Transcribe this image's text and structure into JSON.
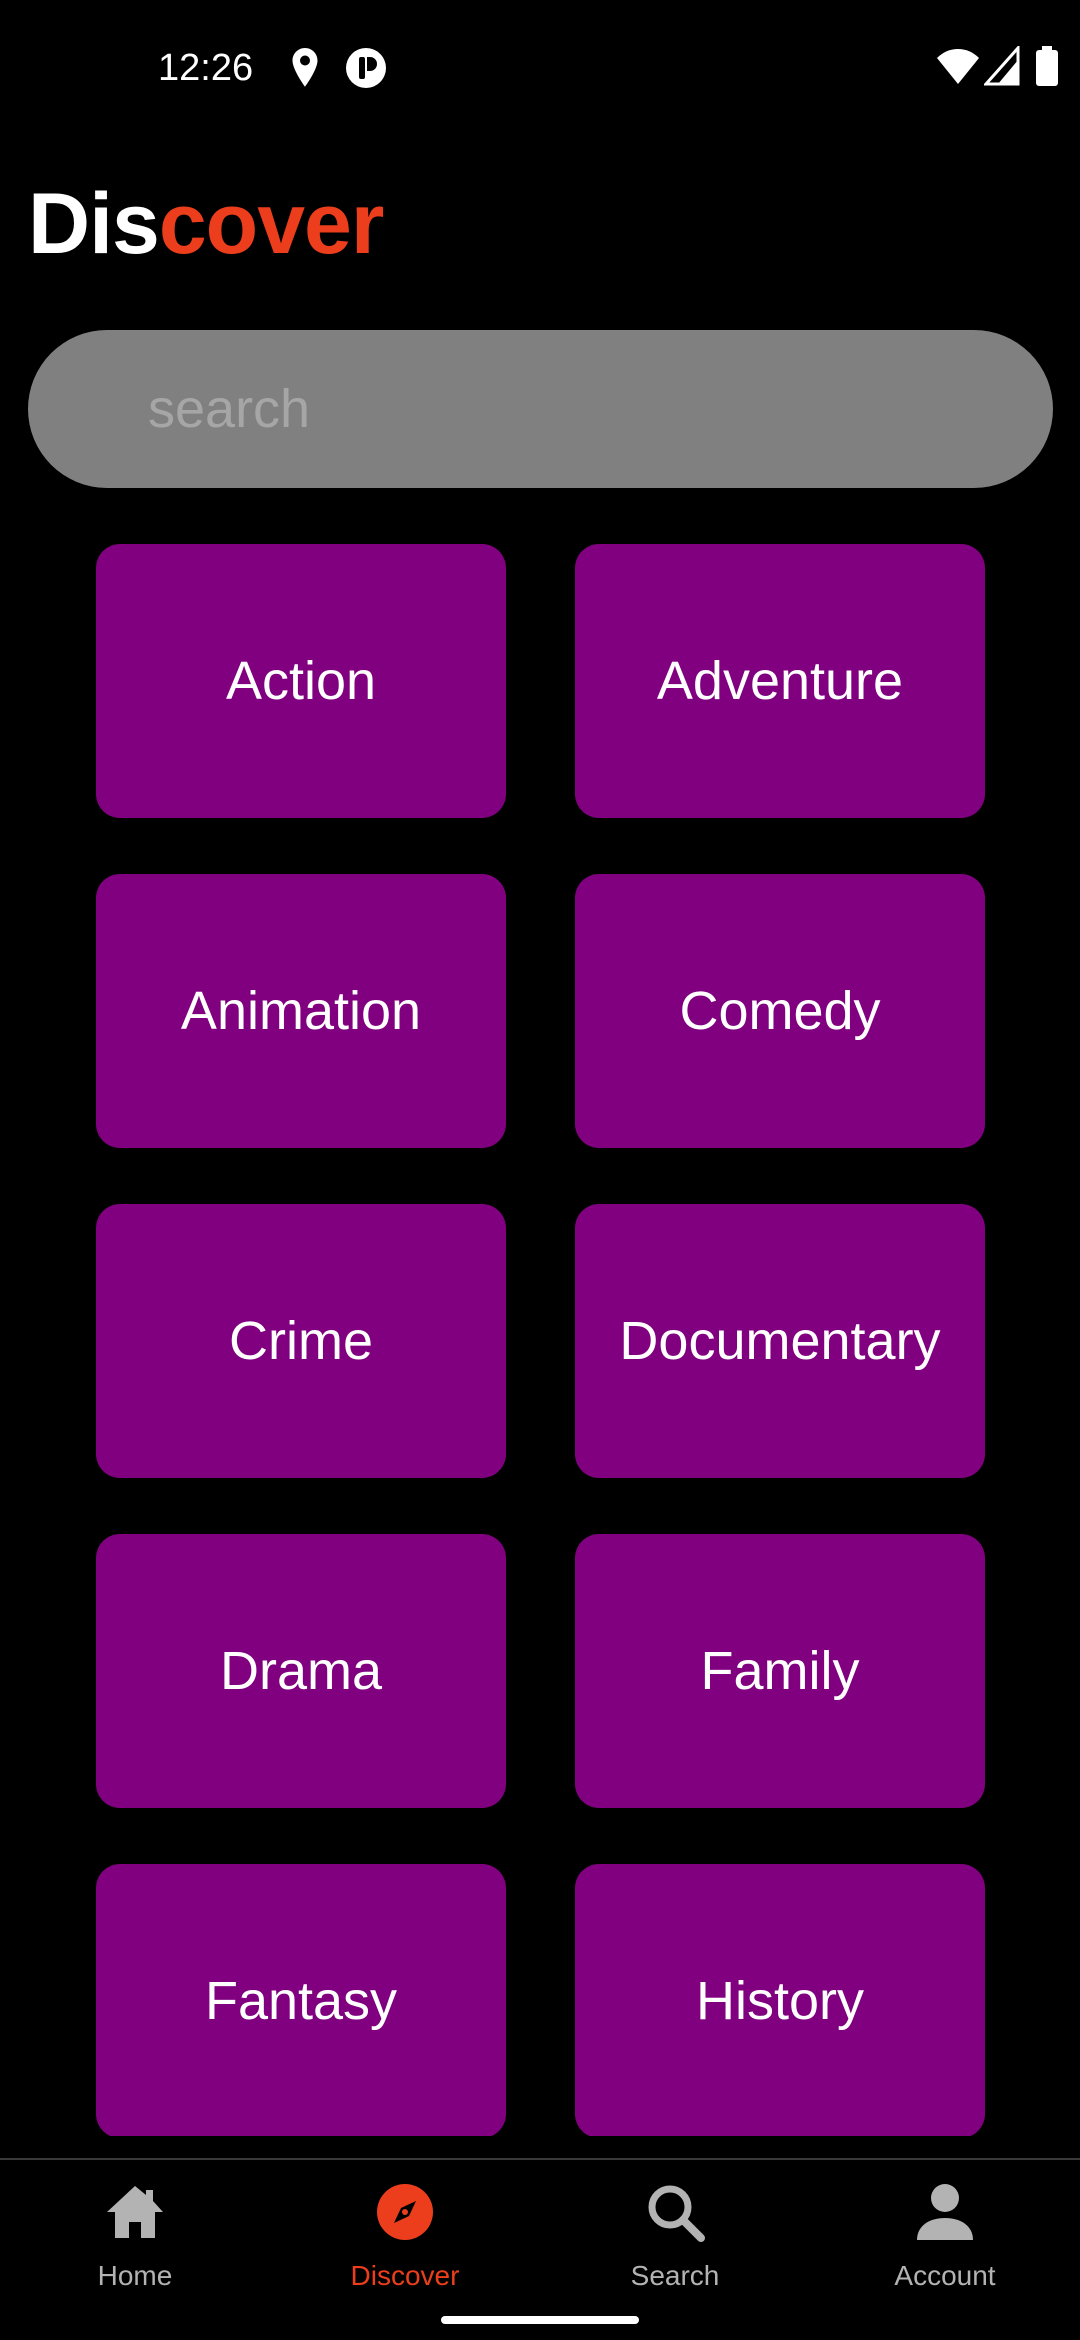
{
  "status_bar": {
    "time": "12:26",
    "icons": [
      "location-icon",
      "app-notification-icon",
      "wifi-icon",
      "signal-icon",
      "battery-icon"
    ]
  },
  "header": {
    "title_part1": "Dis",
    "title_part2": "cover"
  },
  "search": {
    "placeholder": "search",
    "value": ""
  },
  "genres": [
    {
      "label": "Action"
    },
    {
      "label": "Adventure"
    },
    {
      "label": "Animation"
    },
    {
      "label": "Comedy"
    },
    {
      "label": "Crime"
    },
    {
      "label": "Documentary"
    },
    {
      "label": "Drama"
    },
    {
      "label": "Family"
    },
    {
      "label": "Fantasy"
    },
    {
      "label": "History"
    }
  ],
  "bottom_nav": {
    "items": [
      {
        "label": "Home",
        "icon": "home-icon",
        "active": false
      },
      {
        "label": "Discover",
        "icon": "compass-icon",
        "active": true
      },
      {
        "label": "Search",
        "icon": "search-icon",
        "active": false
      },
      {
        "label": "Account",
        "icon": "account-icon",
        "active": false
      }
    ]
  },
  "colors": {
    "background": "#000000",
    "accent": "#ec3e1c",
    "tile": "#800080",
    "search_bg": "#808080",
    "nav_inactive": "#b3b3b3"
  }
}
